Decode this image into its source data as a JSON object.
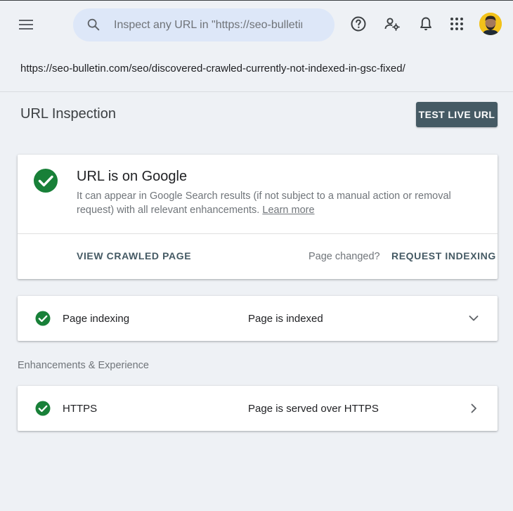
{
  "header": {
    "search_placeholder": "Inspect any URL in \"https://seo-bulletin.com/\"",
    "icons": [
      "menu-icon",
      "search-icon",
      "help-icon",
      "user-settings-icon",
      "bell-icon",
      "apps-grid-icon",
      "avatar"
    ]
  },
  "inspected_url": "https://seo-bulletin.com/seo/discovered-crawled-currently-not-indexed-in-gsc-fixed/",
  "page": {
    "title": "URL Inspection",
    "test_live_url_label": "TEST LIVE URL"
  },
  "status": {
    "title": "URL is on Google",
    "description": "It can appear in Google Search results (if not subject to a manual action or removal request) with all relevant enhancements.",
    "learn_more": "Learn more",
    "view_crawled_label": "VIEW CRAWLED PAGE",
    "page_changed_text": "Page changed?",
    "request_indexing_label": "REQUEST INDEXING"
  },
  "indexing_row": {
    "label": "Page indexing",
    "value": "Page is indexed"
  },
  "enhancements": {
    "heading": "Enhancements & Experience",
    "rows": [
      {
        "label": "HTTPS",
        "value": "Page is served over HTTPS"
      }
    ]
  },
  "colors": {
    "success_green": "#188038",
    "primary_button": "#455a64",
    "search_bg": "#dde7f8",
    "page_bg": "#eef1f5"
  }
}
